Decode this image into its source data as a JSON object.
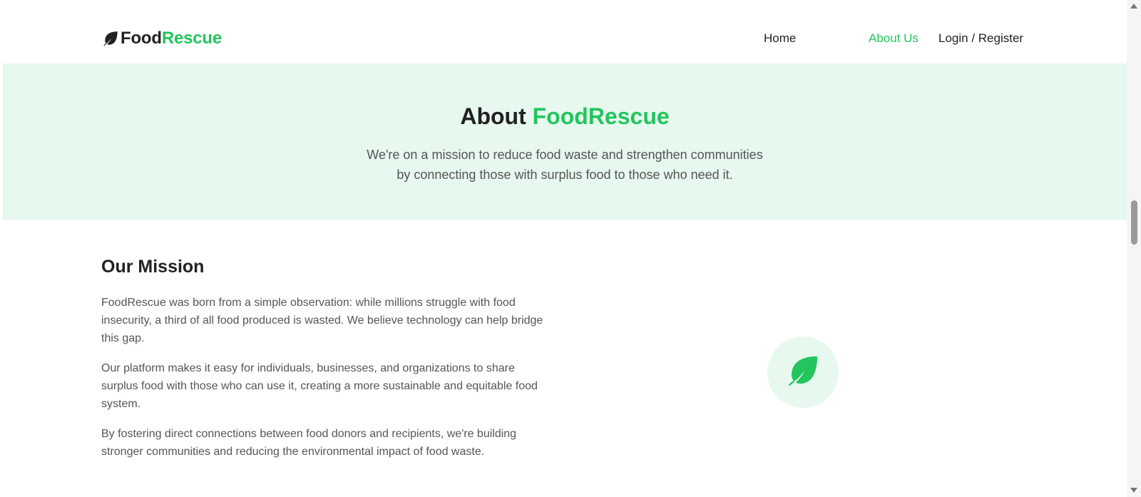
{
  "header": {
    "brand_part1": "Food",
    "brand_part2": "Rescue",
    "nav": {
      "home": "Home",
      "about": "About Us",
      "login": "Login / Register"
    }
  },
  "hero": {
    "title_prefix": "About",
    "title_accent": "FoodRescue",
    "subtitle_line1": "We're on a mission to reduce food waste and strengthen communities",
    "subtitle_line2": "by connecting those with surplus food to those who need it."
  },
  "mission": {
    "heading": "Our Mission",
    "paragraphs": [
      "FoodRescue was born from a simple observation: while millions struggle with food insecurity, a third of all food produced is wasted. We believe technology can help bridge this gap.",
      "Our platform makes it easy for individuals, businesses, and organizations to share surplus food with those who can use it, creating a more sustainable and equitable food system.",
      "By fostering direct connections between food donors and recipients, we're building stronger communities and reducing the environmental impact of food waste."
    ]
  },
  "icons": {
    "brand_logo": "leaf-icon",
    "mission_badge": "leaf-icon"
  },
  "colors": {
    "accent": "#22c55e",
    "hero_background": "#e7f8ee",
    "text_dark": "#222222",
    "text_muted": "#555555"
  }
}
